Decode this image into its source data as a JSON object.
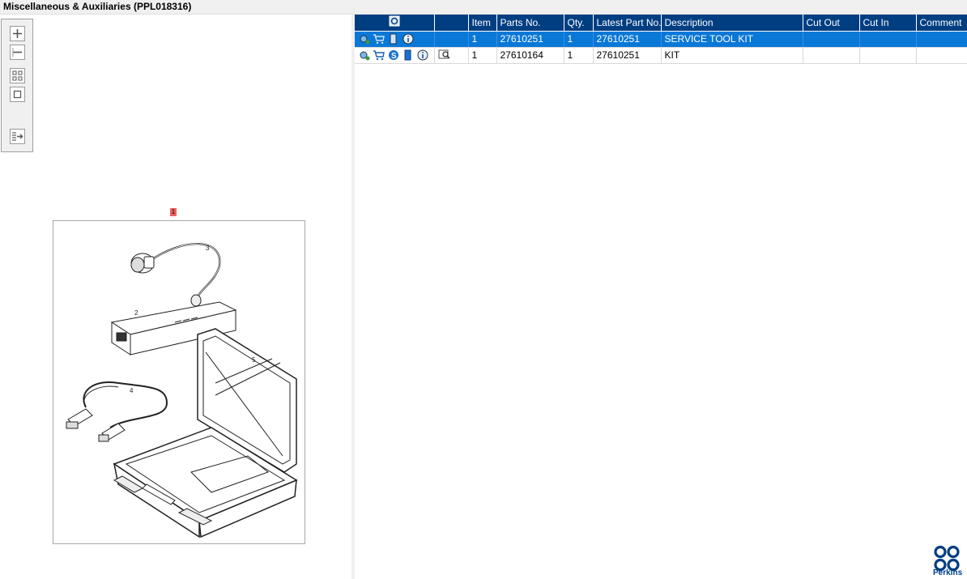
{
  "title": "Miscellaneous & Auxiliaries (PPL018316)",
  "zoom_toolbar": {
    "buttons": [
      "zoom-in-icon",
      "zoom-out-icon",
      "fit-all-icon",
      "fit-window-icon",
      "expand-panel-icon"
    ]
  },
  "drawing": {
    "callouts": [
      "1",
      "2",
      "3",
      "4",
      "5"
    ]
  },
  "table": {
    "headers": [
      "",
      "",
      "Item",
      "Parts No.",
      "Qty.",
      "Latest Part No.",
      "Description",
      "Cut Out",
      "Cut In",
      "Comment"
    ],
    "rows": [
      {
        "item": "1",
        "parts_no": "27610251",
        "qty": "1",
        "latest_part_no": "27610251",
        "description": "SERVICE TOOL KIT",
        "cut_out": "",
        "cut_in": "",
        "comment": "",
        "selected": true
      },
      {
        "item": "1",
        "parts_no": "27610164",
        "qty": "1",
        "latest_part_no": "27610251",
        "description": "KIT",
        "cut_out": "",
        "cut_in": "",
        "comment": "",
        "selected": false
      }
    ]
  },
  "brand": {
    "name": "Perkins",
    "color": "#003e82"
  },
  "colors": {
    "header_bg": "#003e82",
    "selected_row": "#0a78d7",
    "callout_highlight": "#f06060"
  }
}
